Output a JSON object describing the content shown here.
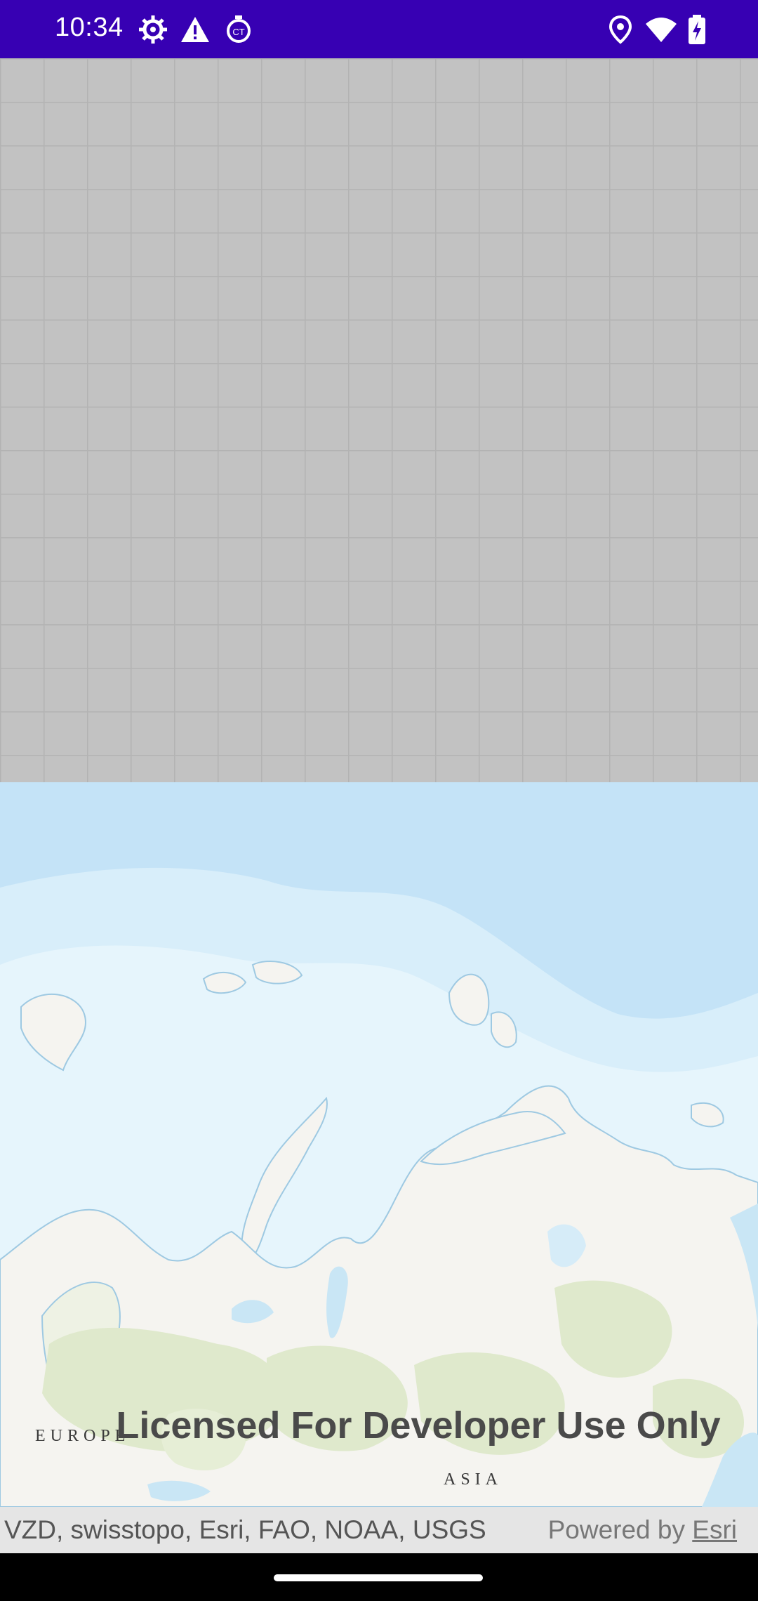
{
  "status_bar": {
    "time": "10:34",
    "left_icons": [
      "settings-gear-icon",
      "warning-icon",
      "ct-timer-icon"
    ],
    "right_icons": [
      "location-pin-icon",
      "wifi-icon",
      "battery-charging-icon"
    ],
    "background": "#3700b3"
  },
  "map": {
    "region_labels": {
      "europe": "EUROPE",
      "asia": "ASIA"
    },
    "watermark": "Licensed For Developer Use Only",
    "attribution": {
      "sources": "VZD, swisstopo, Esri, FAO, NOAA, USGS",
      "powered_by": "Powered by",
      "esri_link": "Esri"
    },
    "colors": {
      "ocean_deep": "#c4e3f7",
      "ocean_shallow": "#e6f5fc",
      "land": "#f5f4f0",
      "vegetation": "#dfe9cc",
      "grid_background": "#c2c2c2"
    }
  },
  "nav": {
    "handle": "gesture-handle"
  }
}
